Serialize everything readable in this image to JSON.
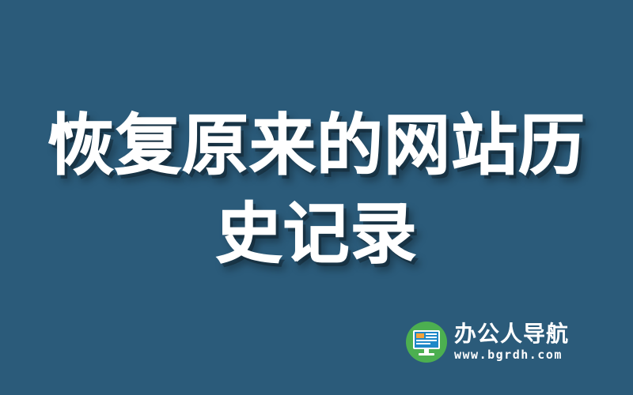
{
  "headline": {
    "line1": "恢复原来的网站历",
    "line2": "史记录"
  },
  "brand": {
    "name": "办公人导航",
    "url": "www.bgrdh.com",
    "logo_icon": "monitor-logo-icon"
  },
  "colors": {
    "background": "#2b5b7a",
    "text": "#ffffff",
    "logo_green": "#4caf50",
    "logo_screen_orange": "#f3a33a",
    "logo_screen_blue": "#1e88c8"
  }
}
